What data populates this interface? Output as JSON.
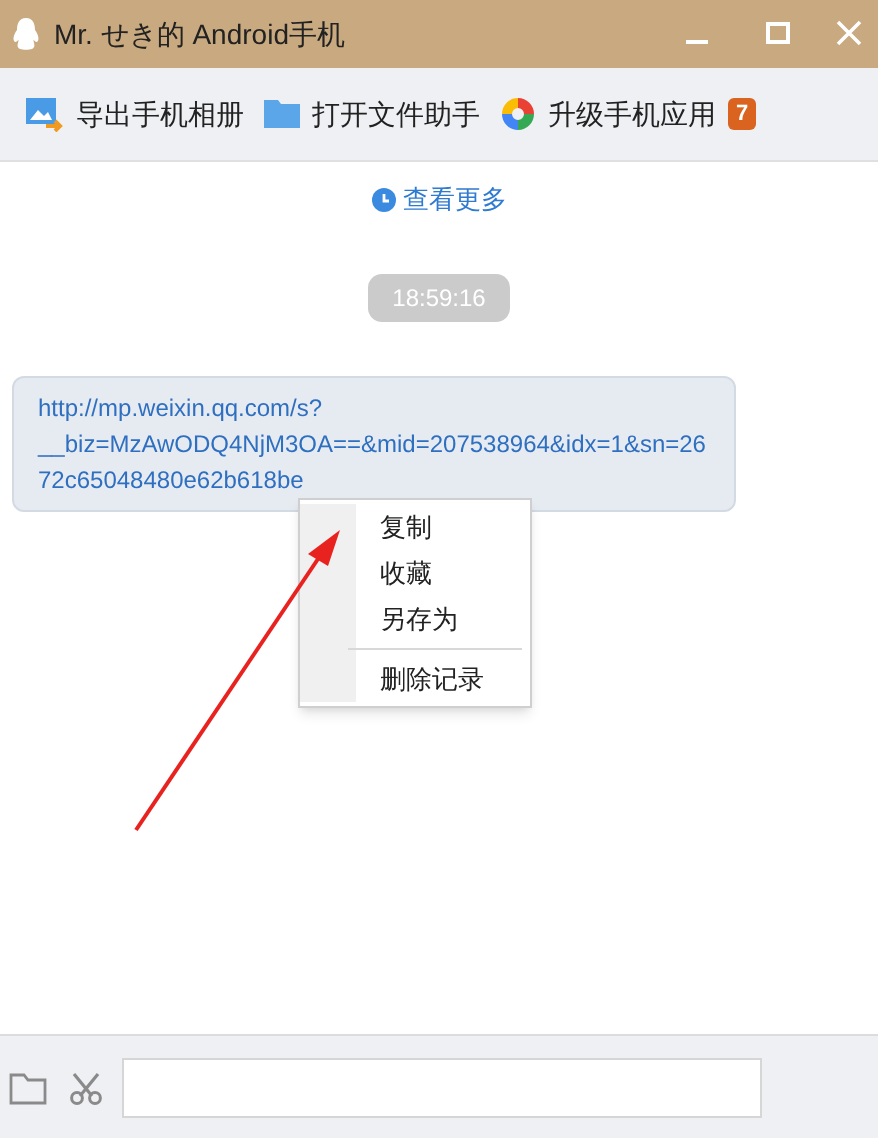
{
  "window": {
    "title": "Mr. せき的 Android手机"
  },
  "toolbar": [
    {
      "kind": "photos",
      "label": "导出手机相册"
    },
    {
      "kind": "folder",
      "label": "打开文件助手"
    },
    {
      "kind": "apps",
      "label": "升级手机应用",
      "badge": "7"
    }
  ],
  "chat": {
    "more_link": "查看更多",
    "timestamp": "18:59:16",
    "message_lines": [
      "http://mp.weixin.qq.com/s?",
      "__biz=MzAwODQ4NjM3OA==&mid=207538964&idx=1&sn=26",
      "72c65048480e62b618be"
    ]
  },
  "context_menu": [
    {
      "label": "复制",
      "separator_before": false
    },
    {
      "label": "收藏",
      "separator_before": false
    },
    {
      "label": "另存为",
      "separator_before": false
    },
    {
      "label": "删除记录",
      "separator_before": true
    }
  ]
}
